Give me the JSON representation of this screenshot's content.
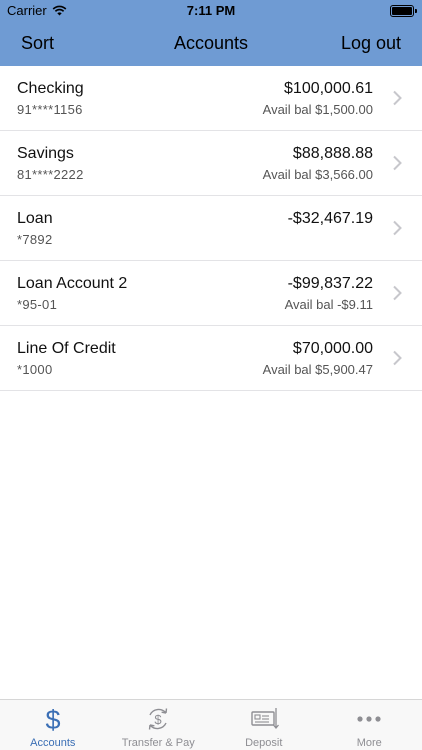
{
  "status_bar": {
    "carrier": "Carrier",
    "time": "7:11 PM",
    "battery_level": 1.0
  },
  "nav": {
    "left": "Sort",
    "title": "Accounts",
    "right": "Log out"
  },
  "accounts": [
    {
      "name": "Checking",
      "number": "91****1156",
      "balance": "$100,000.61",
      "avail": "Avail bal $1,500.00"
    },
    {
      "name": "Savings",
      "number": "81****2222",
      "balance": "$88,888.88",
      "avail": "Avail bal $3,566.00"
    },
    {
      "name": "Loan",
      "number": "*7892",
      "balance": "-$32,467.19",
      "avail": ""
    },
    {
      "name": "Loan Account 2",
      "number": "*95-01",
      "balance": "-$99,837.22",
      "avail": "Avail bal -$9.11"
    },
    {
      "name": "Line Of Credit",
      "number": "*1000",
      "balance": "$70,000.00",
      "avail": "Avail bal $5,900.47"
    }
  ],
  "tabs": [
    {
      "label": "Accounts",
      "icon": "dollar-icon",
      "active": true
    },
    {
      "label": "Transfer & Pay",
      "icon": "transfer-icon",
      "active": false
    },
    {
      "label": "Deposit",
      "icon": "check-deposit-icon",
      "active": false
    },
    {
      "label": "More",
      "icon": "more-icon",
      "active": false
    }
  ],
  "colors": {
    "header": "#6f9bd3",
    "active_tab": "#3b6fb5",
    "inactive_tab": "#8e8e93"
  }
}
